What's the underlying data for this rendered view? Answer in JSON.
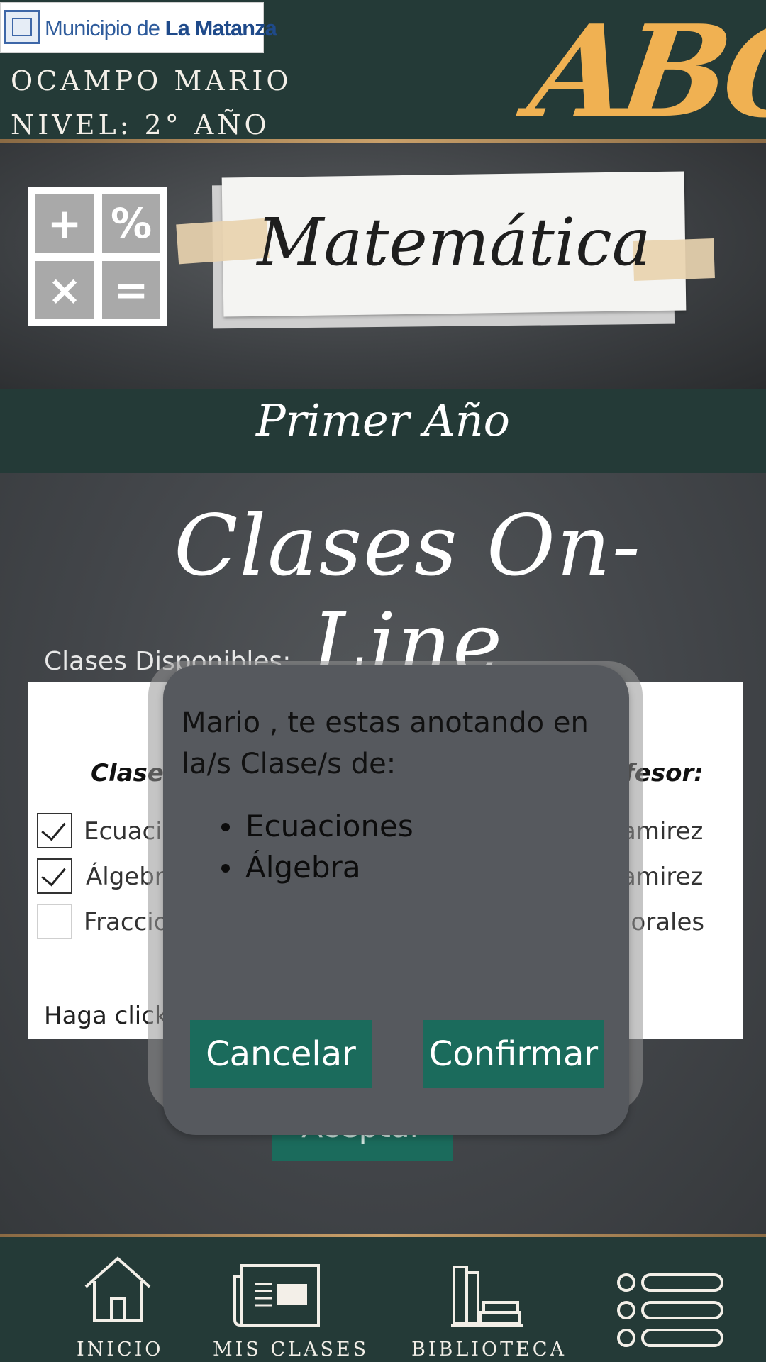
{
  "header": {
    "logo_text_prefix": "Municipio de ",
    "logo_text_bold": "La Matanza",
    "user_name": "OCAMPO MARIO",
    "user_level": "NIVEL: 2° AÑO",
    "brand_logo": "ABC"
  },
  "subject": {
    "title": "Matemática",
    "icon_symbols": [
      "+",
      "%",
      "×",
      "="
    ]
  },
  "year": {
    "title": "Primer Año"
  },
  "board": {
    "title": "Clases On-Line",
    "available_label": "Clases Disponibles:",
    "column_class_header": "Clase",
    "column_teacher_header": "fesor:",
    "rows": [
      {
        "class_text": "Ecuacio",
        "teacher_text": "amirez",
        "checked": true
      },
      {
        "class_text": "Álgebra",
        "teacher_text": "amirez",
        "checked": true
      },
      {
        "class_text": "Fraccio",
        "teacher_text": "lorales",
        "checked": false
      }
    ],
    "click_hint": "Haga click",
    "accept_label": "Aceptar"
  },
  "modal": {
    "message": "Mario , te estas anotando en la/s Clase/s de:",
    "items": [
      "Ecuaciones",
      "Álgebra"
    ],
    "cancel_label": "Cancelar",
    "confirm_label": "Confirmar"
  },
  "nav": {
    "items": [
      {
        "label": "INICIO",
        "icon": "home-icon"
      },
      {
        "label": "MIS CLASES",
        "icon": "newspaper-icon"
      },
      {
        "label": "BIBLIOTECA",
        "icon": "books-icon"
      },
      {
        "label": "",
        "icon": "menu-list-icon"
      }
    ]
  },
  "colors": {
    "header_bg": "#243a37",
    "accent_gold": "#f0b152",
    "button_green": "#1b6b5c",
    "modal_bg": "#56595e"
  }
}
